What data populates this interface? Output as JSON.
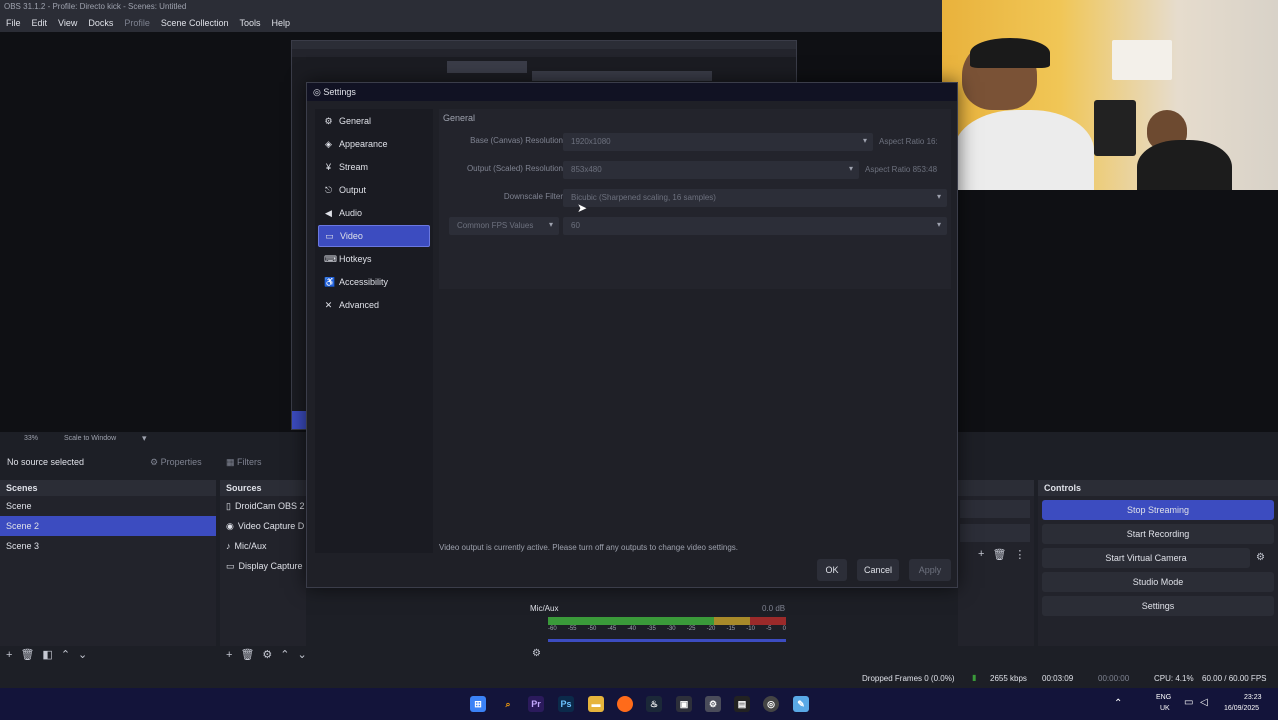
{
  "window": {
    "title": "OBS 31.1.2 - Profile: Directo kick - Scenes: Untitled"
  },
  "menu": [
    "File",
    "Edit",
    "View",
    "Docks",
    "Profile",
    "Scene Collection",
    "Tools",
    "Help"
  ],
  "preview": {
    "zoom": "33%",
    "scale_mode": "Scale to Window"
  },
  "source_bar": {
    "no_source": "No source selected",
    "properties": "Properties",
    "filters": "Filters"
  },
  "scenes": {
    "title": "Scenes",
    "items": [
      "Scene",
      "Scene 2",
      "Scene 3"
    ],
    "selected": 1
  },
  "sources": {
    "title": "Sources",
    "items": [
      "DroidCam OBS 2",
      "Video Capture D",
      "Mic/Aux",
      "Display Capture"
    ]
  },
  "mixer": {
    "channel": "Mic/Aux",
    "level": "0.0 dB",
    "ticks": [
      "-60",
      "-55",
      "-50",
      "-45",
      "-40",
      "-35",
      "-30",
      "-25",
      "-20",
      "-15",
      "-10",
      "-5",
      "0"
    ]
  },
  "controls": {
    "title": "Controls",
    "buttons": [
      "Stop Streaming",
      "Start Recording",
      "Start Virtual Camera",
      "Studio Mode",
      "Settings"
    ]
  },
  "settings": {
    "title": "Settings",
    "nav": [
      "General",
      "Appearance",
      "Stream",
      "Output",
      "Audio",
      "Video",
      "Hotkeys",
      "Accessibility",
      "Advanced"
    ],
    "selected": 5,
    "section": "General",
    "base_label": "Base (Canvas) Resolution",
    "base_value": "1920x1080",
    "base_aspect": "Aspect Ratio 16:",
    "output_label": "Output (Scaled) Resolution",
    "output_value": "853x480",
    "output_aspect": "Aspect Ratio 853:48",
    "filter_label": "Downscale Filter",
    "filter_value": "Bicubic (Sharpened scaling, 16 samples)",
    "fps_type": "Common FPS Values",
    "fps_value": "60",
    "notice": "Video output is currently active. Please turn off any outputs to change video settings.",
    "ok": "OK",
    "cancel": "Cancel",
    "apply": "Apply"
  },
  "status": {
    "dropped": "Dropped Frames 0 (0.0%)",
    "bitrate": "2655 kbps",
    "stream_time": "00:03:09",
    "rec_time": "00:00:00",
    "cpu": "CPU: 4.1%",
    "fps": "60.00 / 60.00 FPS"
  },
  "taskbar": {
    "lang": "ENG",
    "region": "UK",
    "time": "23:23",
    "date": "16/09/2025"
  },
  "colors": {
    "accent": "#3c4cc0",
    "bg": "#1d1f26",
    "dock": "#2b2d36",
    "taskbar": "#13143a"
  }
}
